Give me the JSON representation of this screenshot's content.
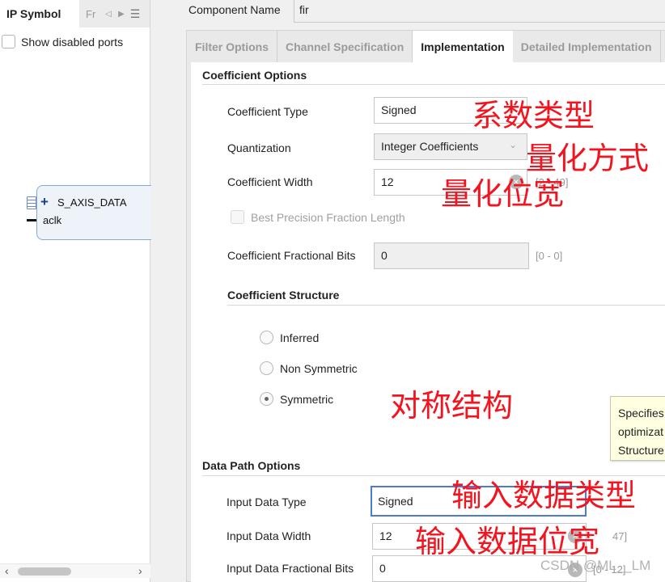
{
  "left_panel": {
    "active_tab": "IP Symbol",
    "other_tab": "Fr",
    "show_disabled_ports": {
      "label": "Show disabled ports",
      "checked": false
    },
    "block": {
      "interface": "S_AXIS_DATA",
      "port": "aclk"
    }
  },
  "component": {
    "label": "Component Name",
    "value": "fir"
  },
  "tabs": [
    {
      "label": "Filter Options",
      "active": false
    },
    {
      "label": "Channel Specification",
      "active": false
    },
    {
      "label": "Implementation",
      "active": true
    },
    {
      "label": "Detailed Implementation",
      "active": false
    }
  ],
  "coefficient_options": {
    "title": "Coefficient Options",
    "coefficient_type": {
      "label": "Coefficient Type",
      "value": "Signed"
    },
    "quantization": {
      "label": "Quantization",
      "value": "Integer Coefficients"
    },
    "coefficient_width": {
      "label": "Coefficient Width",
      "value": "12",
      "range": "[2 - 49]"
    },
    "best_precision": {
      "label": "Best Precision Fraction Length",
      "checked": false,
      "enabled": false
    },
    "fractional_bits": {
      "label": "Coefficient Fractional Bits",
      "value": "0",
      "range": "[0 - 0]"
    }
  },
  "coefficient_structure": {
    "title": "Coefficient Structure",
    "options": [
      {
        "label": "Inferred",
        "selected": false
      },
      {
        "label": "Non Symmetric",
        "selected": false
      },
      {
        "label": "Symmetric",
        "selected": true
      }
    ]
  },
  "tooltip": {
    "lines": [
      "Specifies",
      "optimizat",
      "Structure"
    ]
  },
  "data_path_options": {
    "title": "Data Path Options",
    "input_data_type": {
      "label": "Input Data Type",
      "value": "Signed"
    },
    "input_data_width": {
      "label": "Input Data Width",
      "value": "12",
      "range": "47]"
    },
    "input_fractional_bits": {
      "label": "Input Data Fractional Bits",
      "value": "0",
      "range": "[0 - 12]"
    }
  },
  "annotations": {
    "coef_type": "系数类型",
    "quantization": "量化方式",
    "quant_width": "量化位宽",
    "symmetric": "对称结构",
    "input_type": "输入数据类型",
    "input_width": "输入数据位宽"
  },
  "watermark": "CSDN @ML__LM",
  "icons": {
    "nav_left": "◁",
    "nav_right": "▶",
    "menu": "☰",
    "plus": "+",
    "chevron_down": "⌄",
    "clear": "×",
    "scroll_left": "‹",
    "scroll_right": "›"
  }
}
